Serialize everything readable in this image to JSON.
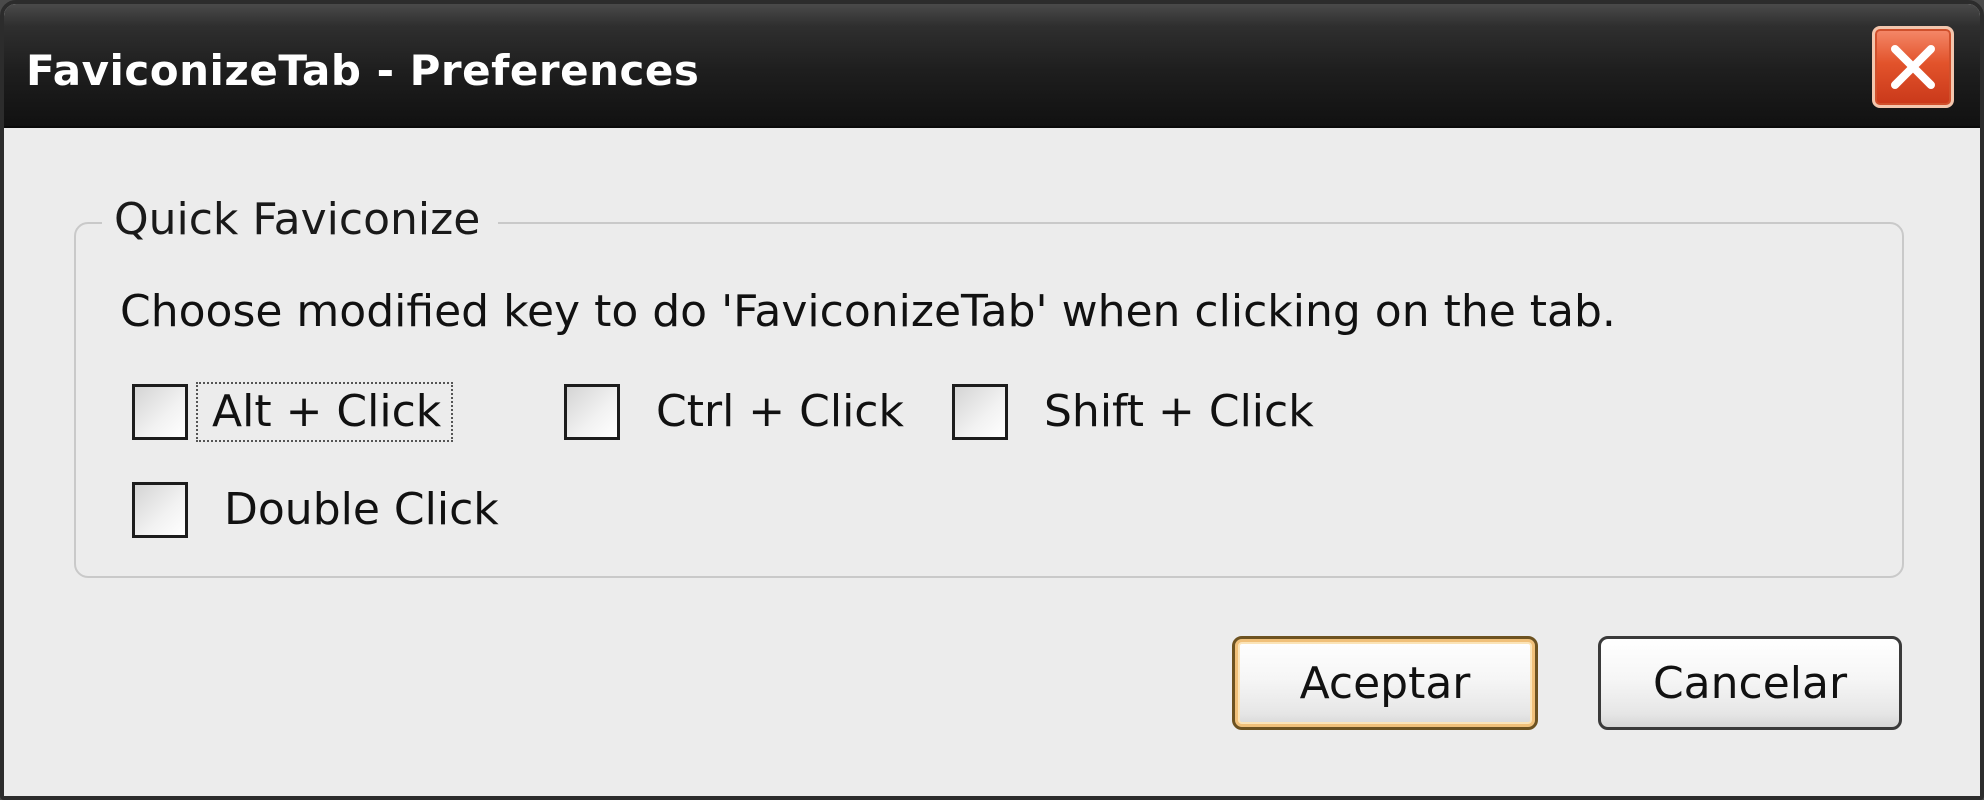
{
  "window": {
    "title": "FaviconizeTab - Preferences",
    "close_icon": "close-icon"
  },
  "group": {
    "legend": "Quick Faviconize",
    "description": "Choose modified key to do 'FaviconizeTab' when clicking on the tab.",
    "options": [
      {
        "label": "Alt + Click",
        "checked": false,
        "focused": true
      },
      {
        "label": "Ctrl + Click",
        "checked": false,
        "focused": false
      },
      {
        "label": "Shift + Click",
        "checked": false,
        "focused": false
      },
      {
        "label": "Double Click",
        "checked": false,
        "focused": false
      }
    ]
  },
  "buttons": {
    "ok_label": "Aceptar",
    "cancel_label": "Cancelar"
  },
  "colors": {
    "titlebar": "#1e1e1e",
    "close_button": "#e2532b",
    "dialog_background": "#ececec",
    "default_button_highlight": "#f0c07a"
  }
}
